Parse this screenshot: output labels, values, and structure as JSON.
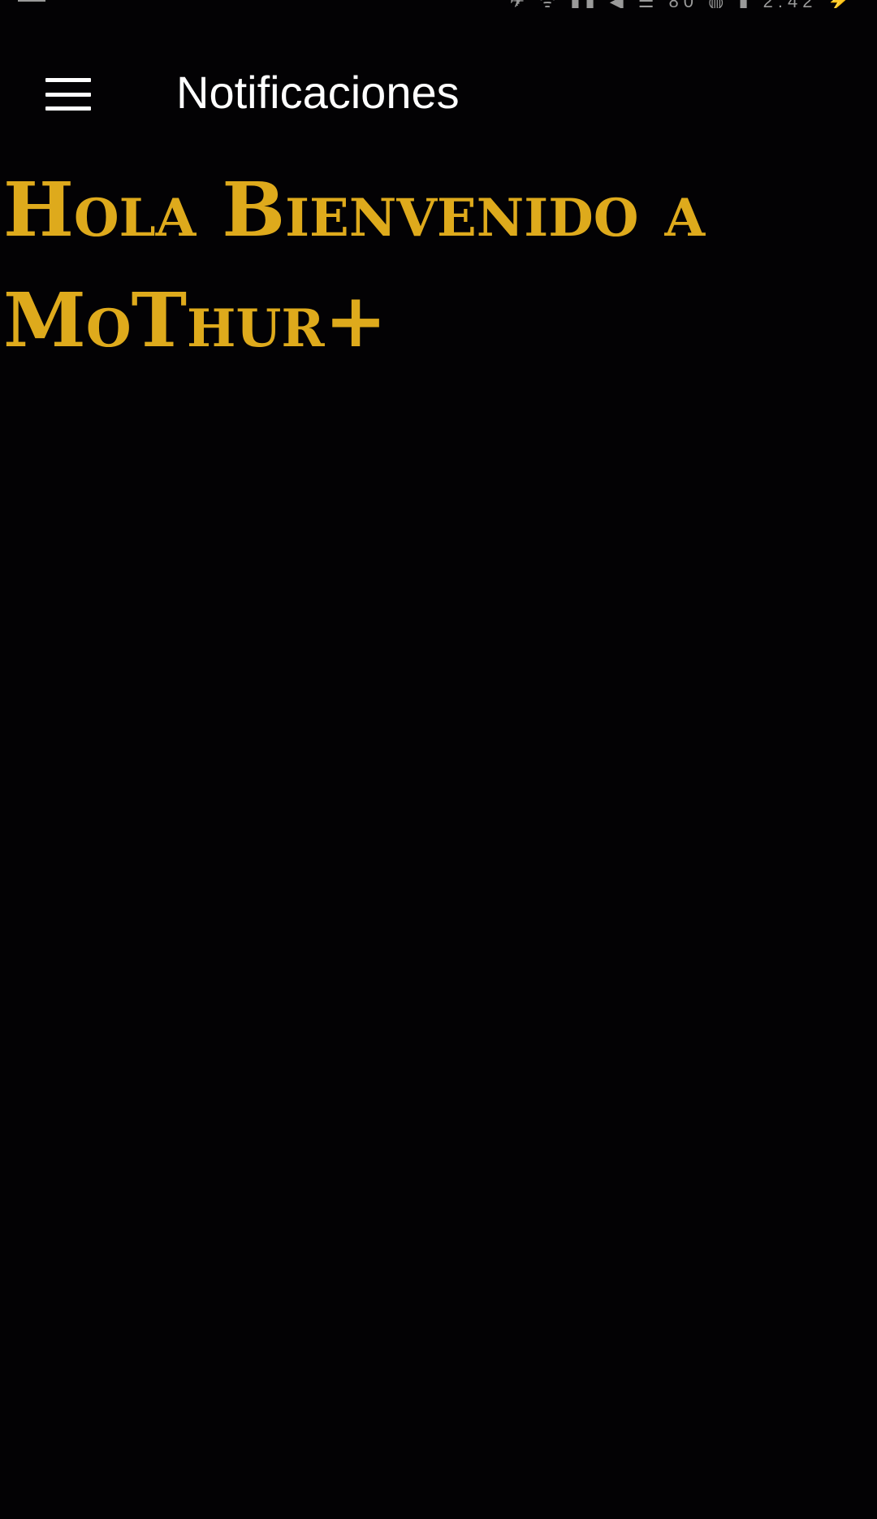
{
  "status_bar": {
    "right_text": "✈ ᯤ ▮▮ ◀ ☰ 80 ◍ ▮ 2:42 ⚡"
  },
  "app_bar": {
    "title": "Notificaciones",
    "menu_icon": "hamburger-menu-icon"
  },
  "main": {
    "welcome_line_1": "Hola Bienvenido a",
    "welcome_line_2": "MoThur+"
  },
  "colors": {
    "background": "#030204",
    "accent": "#deaa1c",
    "title": "#ffffff"
  }
}
